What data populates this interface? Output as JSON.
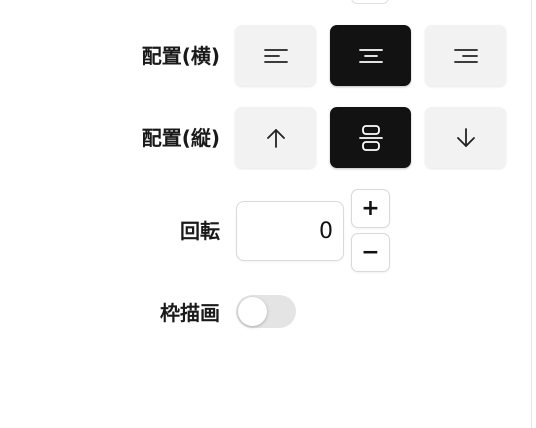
{
  "labels": {
    "align_horizontal": "配置(横)",
    "align_vertical": "配置(縦)",
    "rotation": "回転",
    "frame_draw": "枠描画"
  },
  "align_horizontal": {
    "options": [
      "left-align-icon",
      "center-align-icon",
      "right-align-icon"
    ],
    "selected": 1
  },
  "align_vertical": {
    "options": [
      "align-top-icon",
      "align-middle-icon",
      "align-bottom-icon"
    ],
    "selected": 1
  },
  "rotation": {
    "value": "0",
    "increment_label": "+",
    "decrement_label": "−"
  },
  "frame_draw": {
    "enabled": false
  },
  "colors": {
    "active": "#121212",
    "inactive": "#f2f2f2",
    "toggle_off": "#e4e4e4"
  }
}
